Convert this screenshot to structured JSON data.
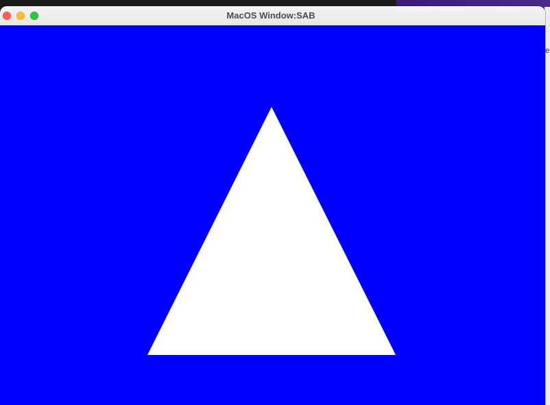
{
  "window": {
    "title": "MacOS Window:SAB"
  },
  "scene": {
    "background_color": "#0000ff",
    "shape": "triangle",
    "shape_color": "#ffffff"
  },
  "background_app": {
    "edge_text": "el"
  }
}
